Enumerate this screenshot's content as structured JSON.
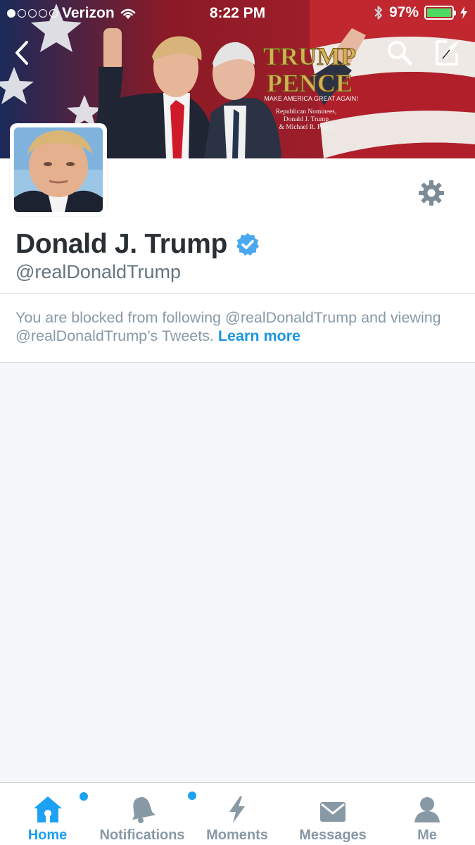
{
  "status_bar": {
    "carrier": "Verizon",
    "time": "8:22 PM",
    "battery": "97%"
  },
  "banner": {
    "line1": "TRUMP",
    "line2": "PENCE",
    "slogan": "MAKE AMERICA GREAT AGAIN!",
    "caption1": "Republican Nominees,",
    "caption2": "Donald J. Trump",
    "caption3": "& Michael R. Pence"
  },
  "profile": {
    "name": "Donald J. Trump",
    "handle": "@realDonaldTrump",
    "verified": true
  },
  "notice": {
    "text": "You are blocked from following @realDonaldTrump and viewing @realDonaldTrump’s Tweets.",
    "link": "Learn more"
  },
  "tabbar": {
    "home": "Home",
    "notifications": "Notifications",
    "moments": "Moments",
    "messages": "Messages",
    "me": "Me"
  },
  "colors": {
    "accent": "#1da1f2",
    "inactive": "#8899a6",
    "verified": "#1da1f2"
  }
}
